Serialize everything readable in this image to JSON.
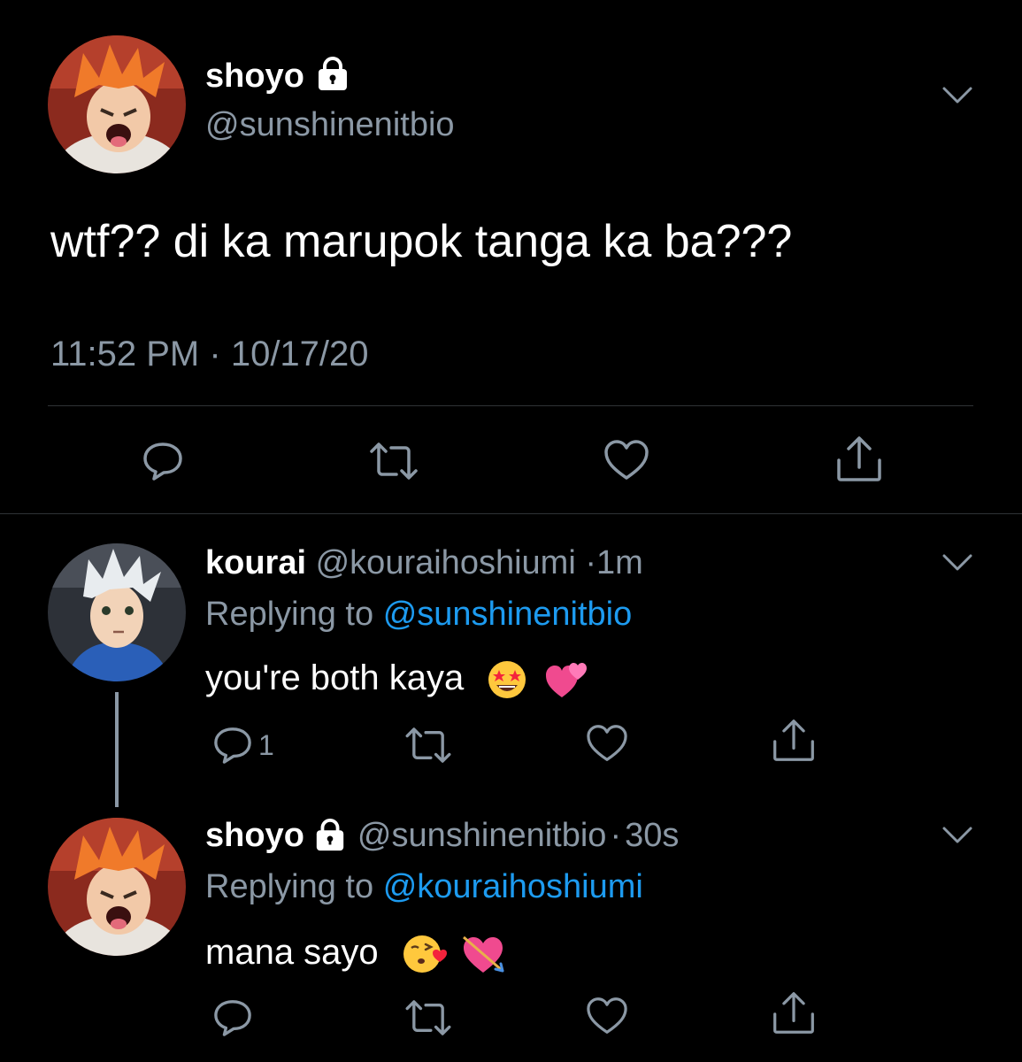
{
  "main_tweet": {
    "name": "shoyo",
    "handle": "@sunshinenitbio",
    "text": "wtf?? di ka marupok tanga ka ba???",
    "time": "11:52 PM",
    "separator": "·",
    "date": "10/17/20"
  },
  "replies": [
    {
      "name": "kourai",
      "handle": "@kouraihoshiumi",
      "dot": "·",
      "time": "1m",
      "replying_prefix": "Replying to",
      "replying_to": "@sunshinenitbio",
      "text": "you're both kaya",
      "emojis": [
        "star-struck-emoji",
        "two-hearts-emoji"
      ],
      "reply_count": "1"
    },
    {
      "name": "shoyo",
      "handle": "@sunshinenitbio",
      "dot": "·",
      "time": "30s",
      "replying_prefix": "Replying to",
      "replying_to": "@kouraihoshiumi",
      "text": "mana sayo",
      "emojis": [
        "kissing-face-emoji",
        "heart-arrow-emoji"
      ]
    }
  ],
  "icons": [
    "lock-icon",
    "chevron-down-icon",
    "reply-icon",
    "retweet-icon",
    "like-icon",
    "share-icon"
  ],
  "colors": {
    "background": "#000000",
    "text": "#ffffff",
    "muted": "#8b98a5",
    "link": "#1d9bf0",
    "divider": "#2f3336"
  }
}
